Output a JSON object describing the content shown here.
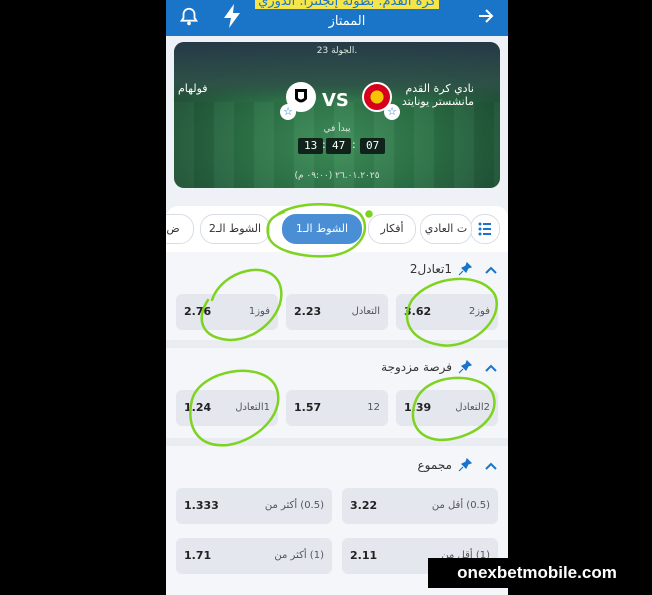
{
  "header": {
    "title_line1": "كرة القدم. بطولة إنجلترا. الدوري",
    "title_line2": "الممتاز",
    "left_icon": "bell-icon",
    "right_icon": "arrow-right-icon"
  },
  "match": {
    "round": "الجولة 23.",
    "home_team": "نادي كرة القدم مانشستر يونايتد",
    "away_team": "فولهام",
    "vs": "VS",
    "starts_label": "يبدأ في",
    "countdown": {
      "hours": "07",
      "minutes": "47",
      "seconds": "13"
    },
    "date": "٢٦.٠١.٢٠٢٥ (٠٩:٠٠ م)"
  },
  "tabs": [
    {
      "label": "ت العادي"
    },
    {
      "label": "أفكار"
    },
    {
      "label": "الشوط الـ1",
      "active": true
    },
    {
      "label": "الشوط الـ2"
    },
    {
      "label": "ض"
    }
  ],
  "markets": [
    {
      "title": "1تعادل2",
      "odds": [
        {
          "label": "فوز2",
          "value": "3.62"
        },
        {
          "label": "التعادل",
          "value": "2.23"
        },
        {
          "label": "فوز1",
          "value": "2.76"
        }
      ]
    },
    {
      "title": "فرصة مزدوجة",
      "odds": [
        {
          "label": "2التعادل",
          "value": "1.39"
        },
        {
          "label": "12",
          "value": "1.57"
        },
        {
          "label": "1التعادل",
          "value": "1.24"
        }
      ]
    },
    {
      "title": "مجموع",
      "odds": [
        {
          "label": "(0.5) أقل من",
          "value": "3.22"
        },
        {
          "label": "(0.5) أكثر من",
          "value": "1.333"
        },
        {
          "label": "(1) أقل من",
          "value": "2.11"
        },
        {
          "label": "(1) أكثر من",
          "value": "1.71"
        }
      ]
    }
  ],
  "watermark": "onexbetmobile.com",
  "colors": {
    "primary": "#1a75c9",
    "tab_active": "#4a8fd6",
    "marker": "#7ed321",
    "highlight": "#f5e54a"
  }
}
